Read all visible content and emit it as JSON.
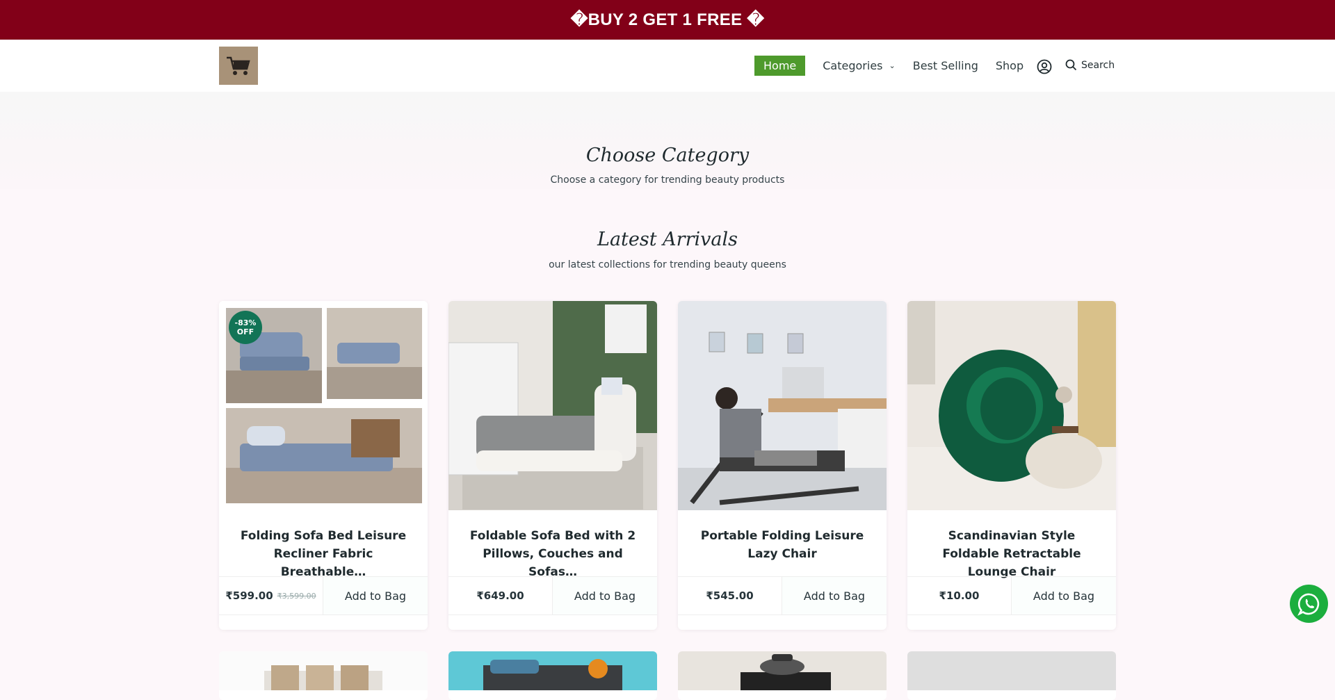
{
  "announcement": "�BUY 2 GET 1 FREE �",
  "nav": {
    "home": "Home",
    "categories": "Categories",
    "categories_chevron": "⌄",
    "best_selling": "Best Selling",
    "shop": "Shop",
    "search": "Search"
  },
  "category_section": {
    "title": "Choose Category",
    "subtitle": "Choose a category for trending beauty products"
  },
  "latest_section": {
    "title": "Latest Arrivals",
    "subtitle": "our latest collections for trending beauty queens"
  },
  "products": [
    {
      "name": "Folding Sofa Bed Leisure Recliner Fabric Breathable…",
      "price": "₹599.00",
      "old_price": "₹3,599.00",
      "badge": "-83% OFF",
      "cta": "Add to Bag"
    },
    {
      "name": "Foldable Sofa Bed with 2 Pillows, Couches and Sofas…",
      "price": "₹649.00",
      "cta": "Add to Bag"
    },
    {
      "name": "Portable Folding Leisure Lazy Chair",
      "price": "₹545.00",
      "cta": "Add to Bag"
    },
    {
      "name": "Scandinavian Style Foldable Retractable Lounge Chair",
      "price": "₹10.00",
      "cta": "Add to Bag"
    }
  ],
  "colors": {
    "announcement_bg": "#820018",
    "nav_active": "#4e9a2c",
    "badge": "#127456",
    "whatsapp": "#1cae3e"
  },
  "icons": [
    "user-icon",
    "search-icon",
    "chevron-down-icon",
    "whatsapp-icon"
  ]
}
